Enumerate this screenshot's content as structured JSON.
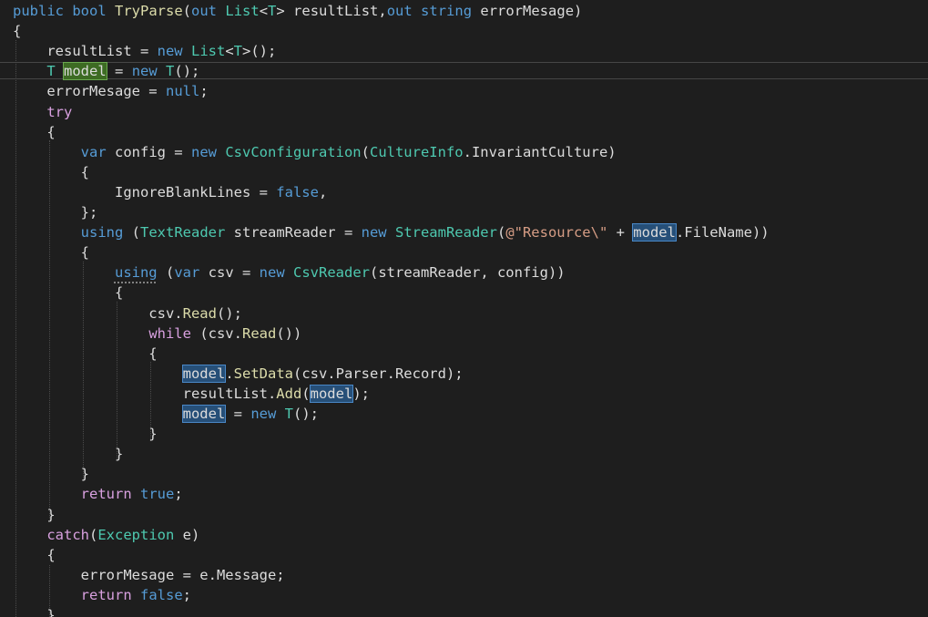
{
  "editor": {
    "lines": [
      [
        {
          "t": "public",
          "c": "kw"
        },
        {
          "t": " "
        },
        {
          "t": "bool",
          "c": "kw"
        },
        {
          "t": " "
        },
        {
          "t": "TryParse",
          "c": "fn"
        },
        {
          "t": "("
        },
        {
          "t": "out",
          "c": "kw"
        },
        {
          "t": " "
        },
        {
          "t": "List",
          "c": "ty"
        },
        {
          "t": "<"
        },
        {
          "t": "T",
          "c": "ty"
        },
        {
          "t": "> resultList,"
        },
        {
          "t": "out",
          "c": "kw"
        },
        {
          "t": " "
        },
        {
          "t": "string",
          "c": "kw"
        },
        {
          "t": " errorMesage)"
        }
      ],
      [
        {
          "t": "{"
        }
      ],
      [
        {
          "t": "    resultList = "
        },
        {
          "t": "new",
          "c": "kw"
        },
        {
          "t": " "
        },
        {
          "t": "List",
          "c": "ty"
        },
        {
          "t": "<"
        },
        {
          "t": "T",
          "c": "ty"
        },
        {
          "t": ">();"
        }
      ],
      [
        {
          "t": "    "
        },
        {
          "t": "T",
          "c": "ty"
        },
        {
          "t": " "
        },
        {
          "t": "model",
          "h": "def"
        },
        {
          "t": " = "
        },
        {
          "t": "new",
          "c": "kw"
        },
        {
          "t": " "
        },
        {
          "t": "T",
          "c": "ty"
        },
        {
          "t": "();"
        }
      ],
      [
        {
          "t": "    errorMesage = "
        },
        {
          "t": "null",
          "c": "kw"
        },
        {
          "t": ";"
        }
      ],
      [
        {
          "t": "    "
        },
        {
          "t": "try",
          "c": "ctl"
        }
      ],
      [
        {
          "t": "    {"
        }
      ],
      [
        {
          "t": "        "
        },
        {
          "t": "var",
          "c": "kw"
        },
        {
          "t": " config = "
        },
        {
          "t": "new",
          "c": "kw"
        },
        {
          "t": " "
        },
        {
          "t": "CsvConfiguration",
          "c": "ty"
        },
        {
          "t": "("
        },
        {
          "t": "CultureInfo",
          "c": "ty"
        },
        {
          "t": ".InvariantCulture)"
        }
      ],
      [
        {
          "t": "        {"
        }
      ],
      [
        {
          "t": "            IgnoreBlankLines = "
        },
        {
          "t": "false",
          "c": "kw"
        },
        {
          "t": ","
        }
      ],
      [
        {
          "t": "        };"
        }
      ],
      [
        {
          "t": "        "
        },
        {
          "t": "using",
          "c": "kw"
        },
        {
          "t": " ("
        },
        {
          "t": "TextReader",
          "c": "ty"
        },
        {
          "t": " streamReader = "
        },
        {
          "t": "new",
          "c": "kw"
        },
        {
          "t": " "
        },
        {
          "t": "StreamReader",
          "c": "ty"
        },
        {
          "t": "("
        },
        {
          "t": "@\"Resource\\\"",
          "c": "str"
        },
        {
          "t": " + "
        },
        {
          "t": "model",
          "h": "ref"
        },
        {
          "t": ".FileName))"
        }
      ],
      [
        {
          "t": "        {"
        }
      ],
      [
        {
          "t": "            "
        },
        {
          "t": "using",
          "c": "kw",
          "u": true
        },
        {
          "t": " ("
        },
        {
          "t": "var",
          "c": "kw"
        },
        {
          "t": " csv = "
        },
        {
          "t": "new",
          "c": "kw"
        },
        {
          "t": " "
        },
        {
          "t": "CsvReader",
          "c": "ty"
        },
        {
          "t": "(streamReader, config))"
        }
      ],
      [
        {
          "t": "            {"
        }
      ],
      [
        {
          "t": "                csv."
        },
        {
          "t": "Read",
          "c": "fn"
        },
        {
          "t": "();"
        }
      ],
      [
        {
          "t": "                "
        },
        {
          "t": "while",
          "c": "ctl"
        },
        {
          "t": " (csv."
        },
        {
          "t": "Read",
          "c": "fn"
        },
        {
          "t": "())"
        }
      ],
      [
        {
          "t": "                {"
        }
      ],
      [
        {
          "t": "                    "
        },
        {
          "t": "model",
          "h": "ref"
        },
        {
          "t": "."
        },
        {
          "t": "SetData",
          "c": "fn"
        },
        {
          "t": "(csv.Parser.Record);"
        }
      ],
      [
        {
          "t": "                    resultList."
        },
        {
          "t": "Add",
          "c": "fn"
        },
        {
          "t": "("
        },
        {
          "t": "model",
          "h": "ref"
        },
        {
          "t": ");"
        }
      ],
      [
        {
          "t": "                    "
        },
        {
          "t": "model",
          "h": "ref"
        },
        {
          "t": " = "
        },
        {
          "t": "new",
          "c": "kw"
        },
        {
          "t": " "
        },
        {
          "t": "T",
          "c": "ty"
        },
        {
          "t": "();"
        }
      ],
      [
        {
          "t": "                }"
        }
      ],
      [
        {
          "t": "            }"
        }
      ],
      [
        {
          "t": "        }"
        }
      ],
      [
        {
          "t": "        "
        },
        {
          "t": "return",
          "c": "ctl"
        },
        {
          "t": " "
        },
        {
          "t": "true",
          "c": "kw"
        },
        {
          "t": ";"
        }
      ],
      [
        {
          "t": "    }"
        }
      ],
      [
        {
          "t": "    "
        },
        {
          "t": "catch",
          "c": "ctl"
        },
        {
          "t": "("
        },
        {
          "t": "Exception",
          "c": "ty"
        },
        {
          "t": " e)"
        }
      ],
      [
        {
          "t": "    {"
        }
      ],
      [
        {
          "t": "        errorMesage = e.Message;"
        }
      ],
      [
        {
          "t": "        "
        },
        {
          "t": "return",
          "c": "ctl"
        },
        {
          "t": " "
        },
        {
          "t": "false",
          "c": "kw"
        },
        {
          "t": ";"
        }
      ],
      [
        {
          "t": "    }"
        }
      ]
    ]
  }
}
